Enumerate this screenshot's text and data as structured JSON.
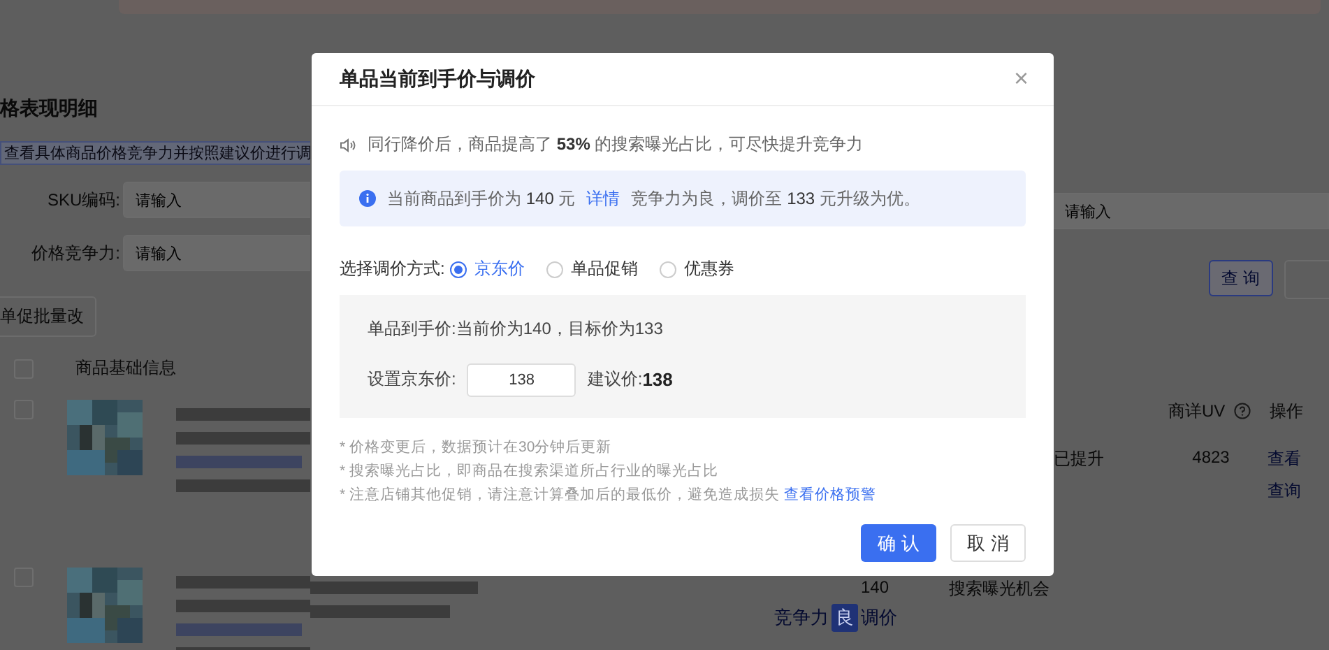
{
  "background": {
    "section_title": "格表现明细",
    "banner": "查看具体商品价格竞争力并按照建议价进行调",
    "filters": [
      {
        "label": "SKU编码:",
        "placeholder": "请输入"
      },
      {
        "label": "价格竞争力:",
        "placeholder": "请输入"
      }
    ],
    "right_filter": {
      "placeholder": "请输入"
    },
    "query_button": "查 询",
    "batch_button": "单促批量改",
    "select_all_checked": false,
    "products": [
      {
        "checked": false
      },
      {
        "checked": false
      }
    ],
    "columns": [
      {
        "label": "商品基础信息"
      },
      {
        "label": "商详UV"
      },
      {
        "label": "操作"
      }
    ],
    "rows": [
      {
        "status": "已提升",
        "uv": "4823",
        "actions": [
          "查看",
          "查询"
        ]
      }
    ],
    "bottom_row": {
      "price": "140",
      "status": "搜索曝光机会",
      "competitiveness": "竞争力",
      "grade": "良",
      "action": "调价"
    }
  },
  "dialog": {
    "title": "单品当前到手价与调价",
    "close": "×",
    "notice": "同行降价后，商品提高了 **53%** 的搜索曝光占比，可尽快提升竞争力",
    "info": {
      "before": "当前商品到手价为 **140** 元",
      "link": "详情",
      "after": "竞争力为良，调价至 **133** 元升级为优。"
    },
    "method_label": "选择调价方式:",
    "methods": [
      {
        "label": "京东价",
        "selected": true
      },
      {
        "label": "单品促销",
        "selected": false
      },
      {
        "label": "优惠券",
        "selected": false
      }
    ],
    "current_label": "单品到手价:",
    "current_text": "当前价为140，目标价为133",
    "set_label": "设置京东价:",
    "price_value": "138",
    "suggest_label": "建议价:",
    "suggest_value": "138",
    "notes": [
      {
        "text": "* 价格变更后，数据预计在30分钟后更新"
      },
      {
        "text": "* 搜索曝光占比，即商品在搜索渠道所占行业的曝光占比"
      },
      {
        "text": "* 注意店铺其他促销，请注意计算叠加后的最低价，避免造成损失",
        "link": "查看价格预警"
      }
    ],
    "confirm": "确 认",
    "cancel": "取 消"
  }
}
